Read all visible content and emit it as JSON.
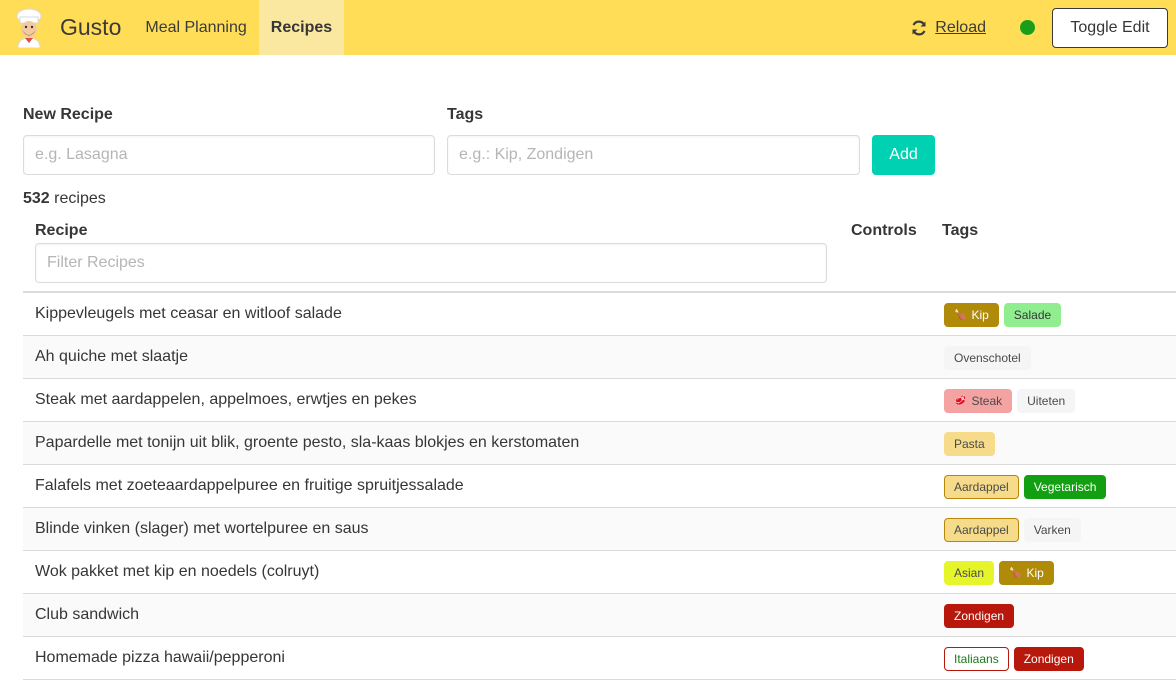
{
  "navbar": {
    "brand": "Gusto",
    "items": [
      {
        "label": "Meal Planning",
        "active": false
      },
      {
        "label": "Recipes",
        "active": true
      }
    ],
    "reload_label": "Reload",
    "toggle_edit_label": "Toggle Edit",
    "status_color": "#1a9e1a"
  },
  "form": {
    "recipe_label": "New Recipe",
    "recipe_placeholder": "e.g. Lasagna",
    "tags_label": "Tags",
    "tags_placeholder": "e.g.: Kip, Zondigen",
    "add_label": "Add"
  },
  "summary": {
    "count": "532",
    "suffix": "recipes"
  },
  "table": {
    "columns": [
      "Recipe",
      "Controls",
      "Tags"
    ],
    "filter_placeholder": "Filter Recipes",
    "rows": [
      {
        "name": "Kippevleugels met ceasar en witloof salade",
        "tags": [
          {
            "label": "Kip",
            "icon": "drumstick-icon",
            "bg": "#b08a09",
            "fg": "#ffffff",
            "border": "#b08a09"
          },
          {
            "label": "Salade",
            "icon": "",
            "bg": "#90ee90",
            "fg": "#363636",
            "border": "#90ee90"
          }
        ]
      },
      {
        "name": "Ah quiche met slaatje",
        "tags": [
          {
            "label": "Ovenschotel",
            "icon": "",
            "bg": "#f5f5f5",
            "fg": "#4a4a4a",
            "border": "#f5f5f5"
          }
        ]
      },
      {
        "name": "Steak met aardappelen, appelmoes, erwtjes en pekes",
        "tags": [
          {
            "label": "Steak",
            "icon": "steak-icon",
            "bg": "#f4a3a3",
            "fg": "#4a4a4a",
            "border": "#f4a3a3"
          },
          {
            "label": "Uiteten",
            "icon": "",
            "bg": "#f5f5f5",
            "fg": "#4a4a4a",
            "border": "#f5f5f5"
          }
        ]
      },
      {
        "name": "Papardelle met tonijn uit blik, groente pesto, sla-kaas blokjes en kerstomaten",
        "tags": [
          {
            "label": "Pasta",
            "icon": "",
            "bg": "#f6dc8a",
            "fg": "#4a4a4a",
            "border": "#f6dc8a"
          }
        ]
      },
      {
        "name": "Falafels met zoeteaardappelpuree en fruitige spruitjessalade",
        "tags": [
          {
            "label": "Aardappel",
            "icon": "",
            "bg": "#f6dc8a",
            "fg": "#4a4a4a",
            "border": "#b8860b"
          },
          {
            "label": "Vegetarisch",
            "icon": "",
            "bg": "#12a012",
            "fg": "#ffffff",
            "border": "#12a012"
          }
        ]
      },
      {
        "name": "Blinde vinken (slager) met wortelpuree en saus",
        "tags": [
          {
            "label": "Aardappel",
            "icon": "",
            "bg": "#f6dc8a",
            "fg": "#4a4a4a",
            "border": "#b8860b"
          },
          {
            "label": "Varken",
            "icon": "",
            "bg": "#f5f5f5",
            "fg": "#4a4a4a",
            "border": "#f5f5f5"
          }
        ]
      },
      {
        "name": "Wok pakket met kip en noedels (colruyt)",
        "tags": [
          {
            "label": "Asian",
            "icon": "",
            "bg": "#e6f52a",
            "fg": "#4a4a4a",
            "border": "#e6f52a"
          },
          {
            "label": "Kip",
            "icon": "drumstick-icon",
            "bg": "#b08a09",
            "fg": "#ffffff",
            "border": "#b08a09"
          }
        ]
      },
      {
        "name": "Club sandwich",
        "tags": [
          {
            "label": "Zondigen",
            "icon": "",
            "bg": "#b8170c",
            "fg": "#ffffff",
            "border": "#b8170c"
          }
        ]
      },
      {
        "name": "Homemade pizza hawaii/pepperoni",
        "tags": [
          {
            "label": "Italiaans",
            "icon": "",
            "bg": "#ffffff",
            "fg": "#1c7a1c",
            "border": "#b8170c"
          },
          {
            "label": "Zondigen",
            "icon": "",
            "bg": "#b8170c",
            "fg": "#ffffff",
            "border": "#b8170c"
          }
        ]
      }
    ]
  }
}
